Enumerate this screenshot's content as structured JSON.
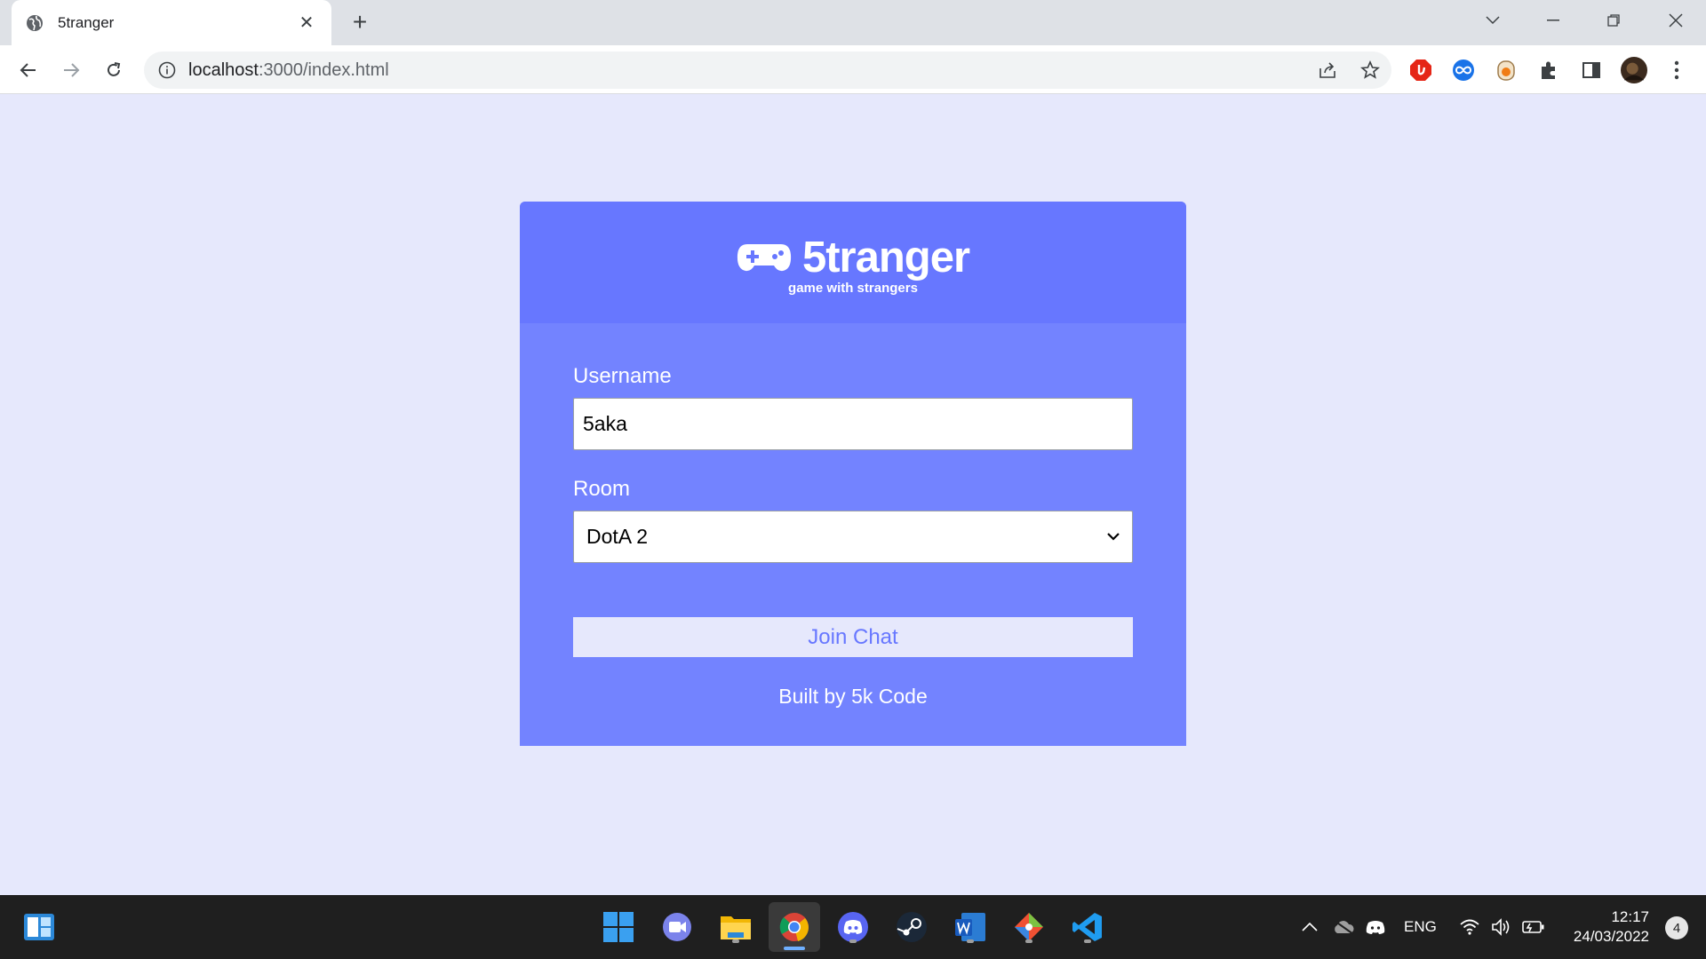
{
  "browser": {
    "tab_title": "5tranger",
    "url_host": "localhost",
    "url_path": ":3000/index.html"
  },
  "app": {
    "brand": "5tranger",
    "tagline": "game with strangers",
    "username_label": "Username",
    "username_value": "5aka",
    "room_label": "Room",
    "room_value": "DotA 2",
    "join_label": "Join Chat",
    "footer": "Built by 5k Code"
  },
  "taskbar": {
    "language": "ENG",
    "time": "12:17",
    "date": "24/03/2022",
    "notifications": "4"
  },
  "colors": {
    "page_bg": "#e6e8fc",
    "card_bg": "#7383ff",
    "header_bg": "#6777ff",
    "button_text": "#6777ff"
  }
}
